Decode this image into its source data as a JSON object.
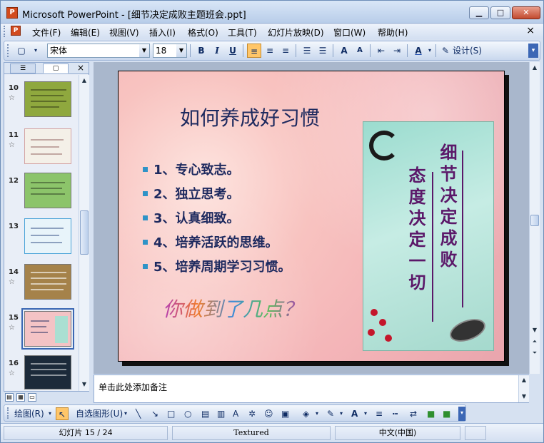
{
  "window": {
    "app_badge": "P",
    "title": "Microsoft PowerPoint - [细节决定成败主题班会.ppt]",
    "controls": {
      "minimize": "▁",
      "maximize": "□",
      "close": "✕"
    }
  },
  "menu": {
    "items": [
      "文件(F)",
      "编辑(E)",
      "视图(V)",
      "插入(I)",
      "格式(O)",
      "工具(T)",
      "幻灯片放映(D)",
      "窗口(W)",
      "帮助(H)"
    ],
    "doc_close": "×"
  },
  "format_toolbar": {
    "font": "宋体",
    "size": "18",
    "bold": "B",
    "italic": "I",
    "underline": "U",
    "design_label": "设计(S)"
  },
  "slides_panel": {
    "close": "×",
    "thumbs": [
      {
        "num": "10",
        "bg": "#8fa83e"
      },
      {
        "num": "11",
        "bg": "#f4f0e8"
      },
      {
        "num": "12",
        "bg": "#8cc46a"
      },
      {
        "num": "13",
        "bg": "#e8f4fa"
      },
      {
        "num": "14",
        "bg": "#a5824a"
      },
      {
        "num": "15",
        "bg": "#f4c3c5"
      },
      {
        "num": "16",
        "bg": "#1c2a3a"
      }
    ],
    "star": "☆"
  },
  "slide": {
    "title": "如何养成好习惯",
    "bullets": [
      "1、专心致志。",
      "2、独立思考。",
      "3、认真细致。",
      "4、培养活跃的思维。",
      "5、培养周期学习习惯。"
    ],
    "wordart": "你做到了几点？",
    "poster_right": "细节决定成败",
    "poster_left": "态度决定一切"
  },
  "notes": {
    "placeholder": "单击此处添加备注"
  },
  "drawing_toolbar": {
    "draw_label": "绘图(R)",
    "autoshapes_label": "自选图形(U)"
  },
  "status": {
    "slide_pos": "幻灯片 15 / 24",
    "design": "Textured",
    "language": "中文(中国)"
  }
}
